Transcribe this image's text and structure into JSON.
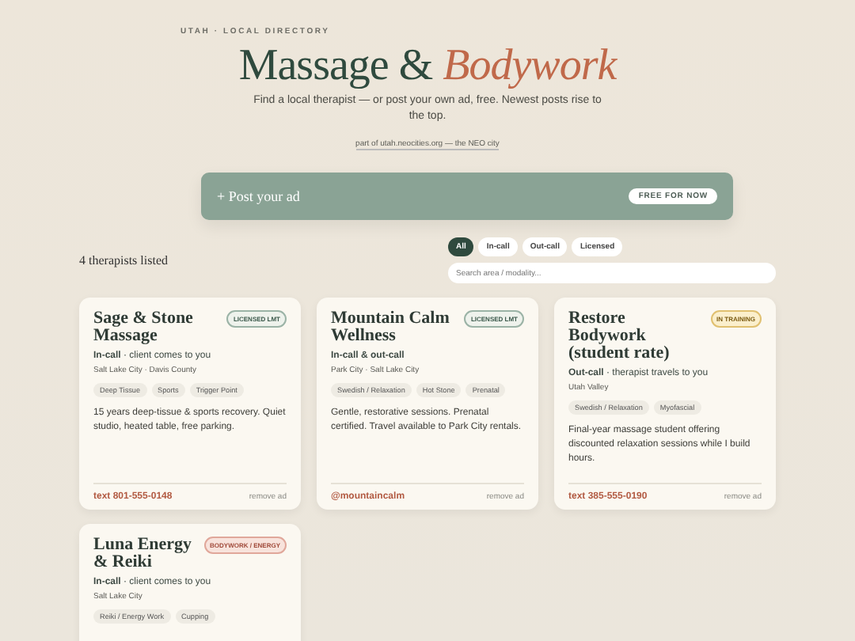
{
  "header": {
    "eyebrow": "UTAH · LOCAL DIRECTORY",
    "title_main": "Massage &",
    "title_accent": "Bodywork",
    "subtitle": "Find a local therapist — or post your own ad, free. Newest posts rise to the top.",
    "link": "part of utah.neocities.org — the NEO city"
  },
  "post_ad": {
    "label": "+ Post your ad",
    "badge": "FREE FOR NOW"
  },
  "count": "4 therapists listed",
  "filters": [
    {
      "label": "All",
      "selected": true
    },
    {
      "label": "In-call",
      "selected": false
    },
    {
      "label": "Out-call",
      "selected": false
    },
    {
      "label": "Licensed",
      "selected": false
    }
  ],
  "search": {
    "placeholder": "Search area / modality..."
  },
  "listings": [
    {
      "name": "Sage & Stone Massage",
      "badge": "LICENSED LMT",
      "kind": "licensed",
      "mode": "**In-call** · client comes to you",
      "area": "Salt Lake City · Davis County",
      "tags": [
        "Deep Tissue",
        "Sports",
        "Trigger Point"
      ],
      "description": "15 years deep-tissue & sports recovery. Quiet studio, heated table, free parking.",
      "contact": "text 801-555-0148",
      "remove": "remove ad"
    },
    {
      "name": "Mountain Calm Wellness",
      "badge": "LICENSED LMT",
      "kind": "licensed",
      "mode": "**In-call & out-call**",
      "area": "Park City · Salt Lake City",
      "tags": [
        "Swedish / Relaxation",
        "Hot Stone",
        "Prenatal"
      ],
      "description": "Gentle, restorative sessions. Prenatal certified. Travel available to Park City rentals.",
      "contact": "@mountaincalm",
      "remove": "remove ad"
    },
    {
      "name": "Restore Bodywork (student rate)",
      "badge": "IN TRAINING",
      "kind": "training",
      "mode": "**Out-call** · therapist travels to you",
      "area": "Utah Valley",
      "tags": [
        "Swedish / Relaxation",
        "Myofascial"
      ],
      "description": "Final-year massage student offering discounted relaxation sessions while I build hours.",
      "contact": "text 385-555-0190",
      "remove": "remove ad"
    },
    {
      "name": "Luna Energy & Reiki",
      "badge": "BODYWORK / ENERGY",
      "kind": "bodywork",
      "mode": "**In-call** · client comes to you",
      "area": "Salt Lake City",
      "tags": [
        "Reiki / Energy Work",
        "Cupping"
      ]
    }
  ]
}
